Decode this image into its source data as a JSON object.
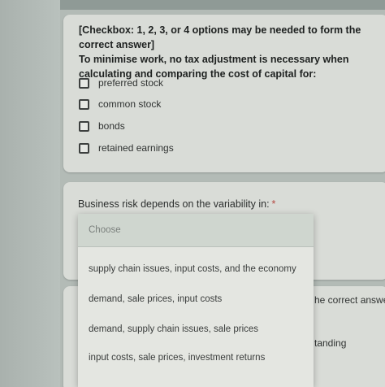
{
  "question_checkbox": {
    "text": "[Checkbox: 1, 2, 3, or 4 options may be needed to form the correct answer]\nTo minimise work, no tax adjustment is necessary when calculating and comparing the cost of capital for:",
    "options": [
      {
        "label": "preferred stock",
        "checked": false
      },
      {
        "label": "common stock",
        "checked": false
      },
      {
        "label": "bonds",
        "checked": false
      },
      {
        "label": "retained earnings",
        "checked": false
      }
    ]
  },
  "question_risk": {
    "text": "Business risk depends on the variability in:",
    "required_marker": "*",
    "dropdown": {
      "placeholder": "Choose",
      "options": [
        "supply chain issues, input costs, and the economy",
        "demand, sale prices, input costs",
        "demand, supply chain issues, sale prices",
        "input costs, sale prices, investment returns"
      ]
    }
  },
  "question_next_partial": {
    "fragment_1": "he correct answe",
    "fragment_2": "tanding"
  },
  "colors": {
    "page_background": "#b3bbb6",
    "card_background": "#d9dcd7",
    "menu_background": "#e4e6e1",
    "required_asterisk": "#b54a43"
  }
}
